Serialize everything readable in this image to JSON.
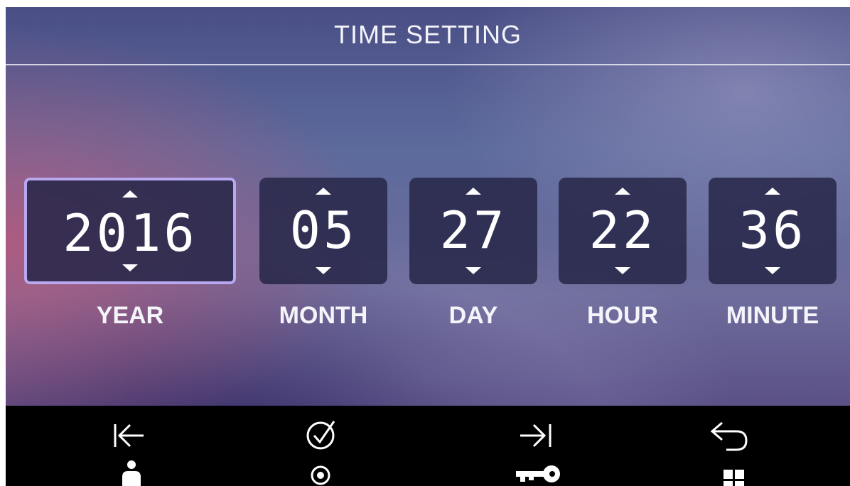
{
  "header": {
    "title": "TIME SETTING"
  },
  "fields": [
    {
      "key": "year",
      "value": "2016",
      "label": "YEAR",
      "selected": true
    },
    {
      "key": "month",
      "value": "05",
      "label": "MONTH",
      "selected": false
    },
    {
      "key": "day",
      "value": "27",
      "label": "DAY",
      "selected": false
    },
    {
      "key": "hour",
      "value": "22",
      "label": "HOUR",
      "selected": false
    },
    {
      "key": "minute",
      "value": "36",
      "label": "MINUTE",
      "selected": false
    }
  ],
  "toolbar": {
    "buttons": [
      {
        "name": "previous",
        "icon": "arrow-left-to-bar-icon",
        "sub_icon": "user-icon"
      },
      {
        "name": "confirm",
        "icon": "check-circle-icon",
        "sub_icon": "record-icon"
      },
      {
        "name": "next",
        "icon": "arrow-right-to-bar-icon",
        "sub_icon": "key-icon"
      },
      {
        "name": "back",
        "icon": "return-arrow-icon",
        "sub_icon": "grid-icon"
      }
    ]
  },
  "colors": {
    "selection_border": "#b8a8f0",
    "toolbar_background": "#000000",
    "spinner_background": "#262648",
    "text": "#ffffff"
  }
}
